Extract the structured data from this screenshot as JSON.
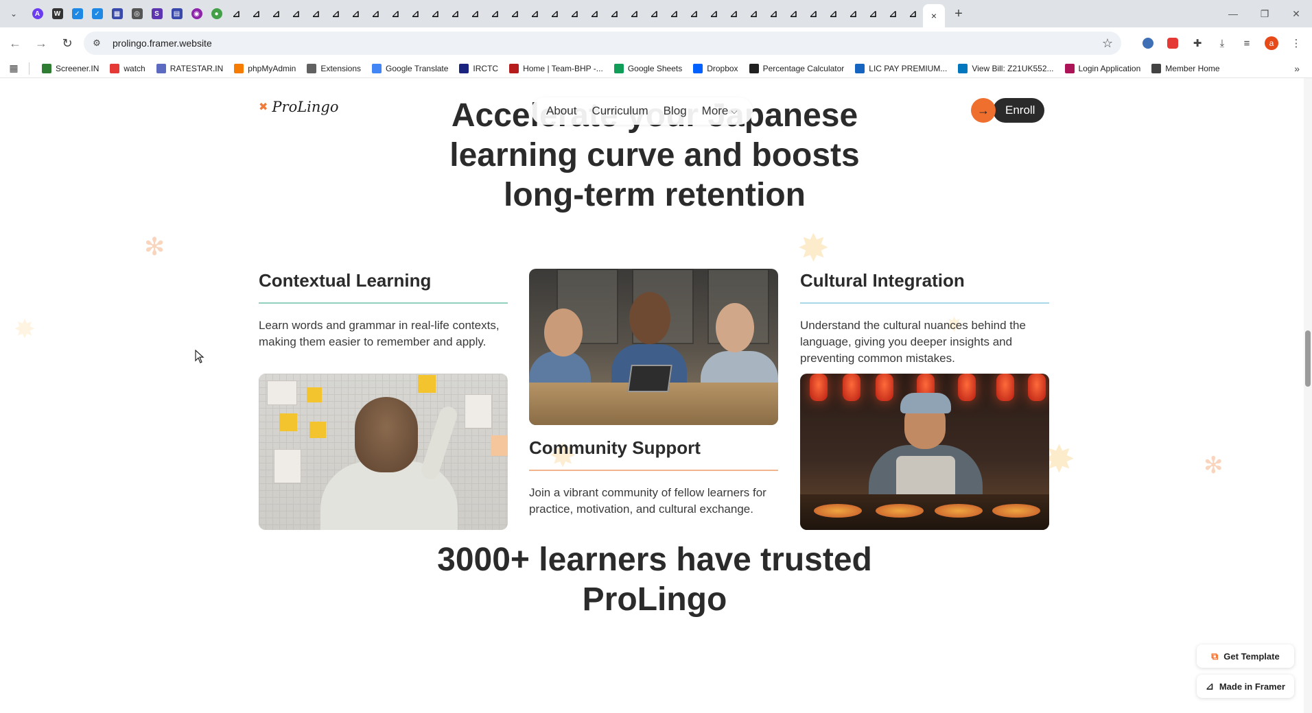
{
  "browser": {
    "active_tab_close": "×",
    "new_tab": "+",
    "url": "prolingo.framer.website",
    "bookmarks": [
      {
        "label": "Screener.IN",
        "color": "#2e7d32"
      },
      {
        "label": "watch",
        "color": "#e53935"
      },
      {
        "label": "RATESTAR.IN",
        "color": "#5c6bc0"
      },
      {
        "label": "phpMyAdmin",
        "color": "#f57c00"
      },
      {
        "label": "Extensions",
        "color": "#616161"
      },
      {
        "label": "Google Translate",
        "color": "#4285f4"
      },
      {
        "label": "IRCTC",
        "color": "#1a237e"
      },
      {
        "label": "Home | Team-BHP -...",
        "color": "#b71c1c"
      },
      {
        "label": "Google Sheets",
        "color": "#0f9d58"
      },
      {
        "label": "Dropbox",
        "color": "#0061ff"
      },
      {
        "label": "Percentage Calculator",
        "color": "#212121"
      },
      {
        "label": "LIC PAY PREMIUM...",
        "color": "#1565c0"
      },
      {
        "label": "View Bill: Z21UK552...",
        "color": "#0277bd"
      },
      {
        "label": "Login Application",
        "color": "#ad1457"
      },
      {
        "label": "Member Home",
        "color": "#424242"
      }
    ],
    "profile_initial": "a"
  },
  "site": {
    "logo": "ProLingo",
    "nav": {
      "about": "About",
      "curriculum": "Curriculum",
      "blog": "Blog",
      "more": "More"
    },
    "enroll": "Enroll",
    "hero_title": "Accelerate your Japanese learning curve and boosts long-term retention",
    "features": {
      "contextual": {
        "title": "Contextual Learning",
        "desc": "Learn words and grammar in real-life contexts, making them easier to remember and apply.",
        "line_color": "#8fd0bf"
      },
      "community": {
        "title": "Community Support",
        "desc": "Join a vibrant community of fellow learners for practice, motivation, and cultural exchange.",
        "line_color": "#f2b48c"
      },
      "cultural": {
        "title": "Cultural Integration",
        "desc": "Understand the cultural nuances behind the language, giving you deeper insights and preventing common mistakes.",
        "line_color": "#a8d8e8"
      }
    },
    "learners_title": "3000+ learners have trusted ProLingo"
  },
  "framer": {
    "get_template": "Get Template",
    "made_in_framer": "Made in Framer"
  },
  "colors": {
    "accent": "#ef6f2e",
    "dark": "#2a2a2a"
  }
}
